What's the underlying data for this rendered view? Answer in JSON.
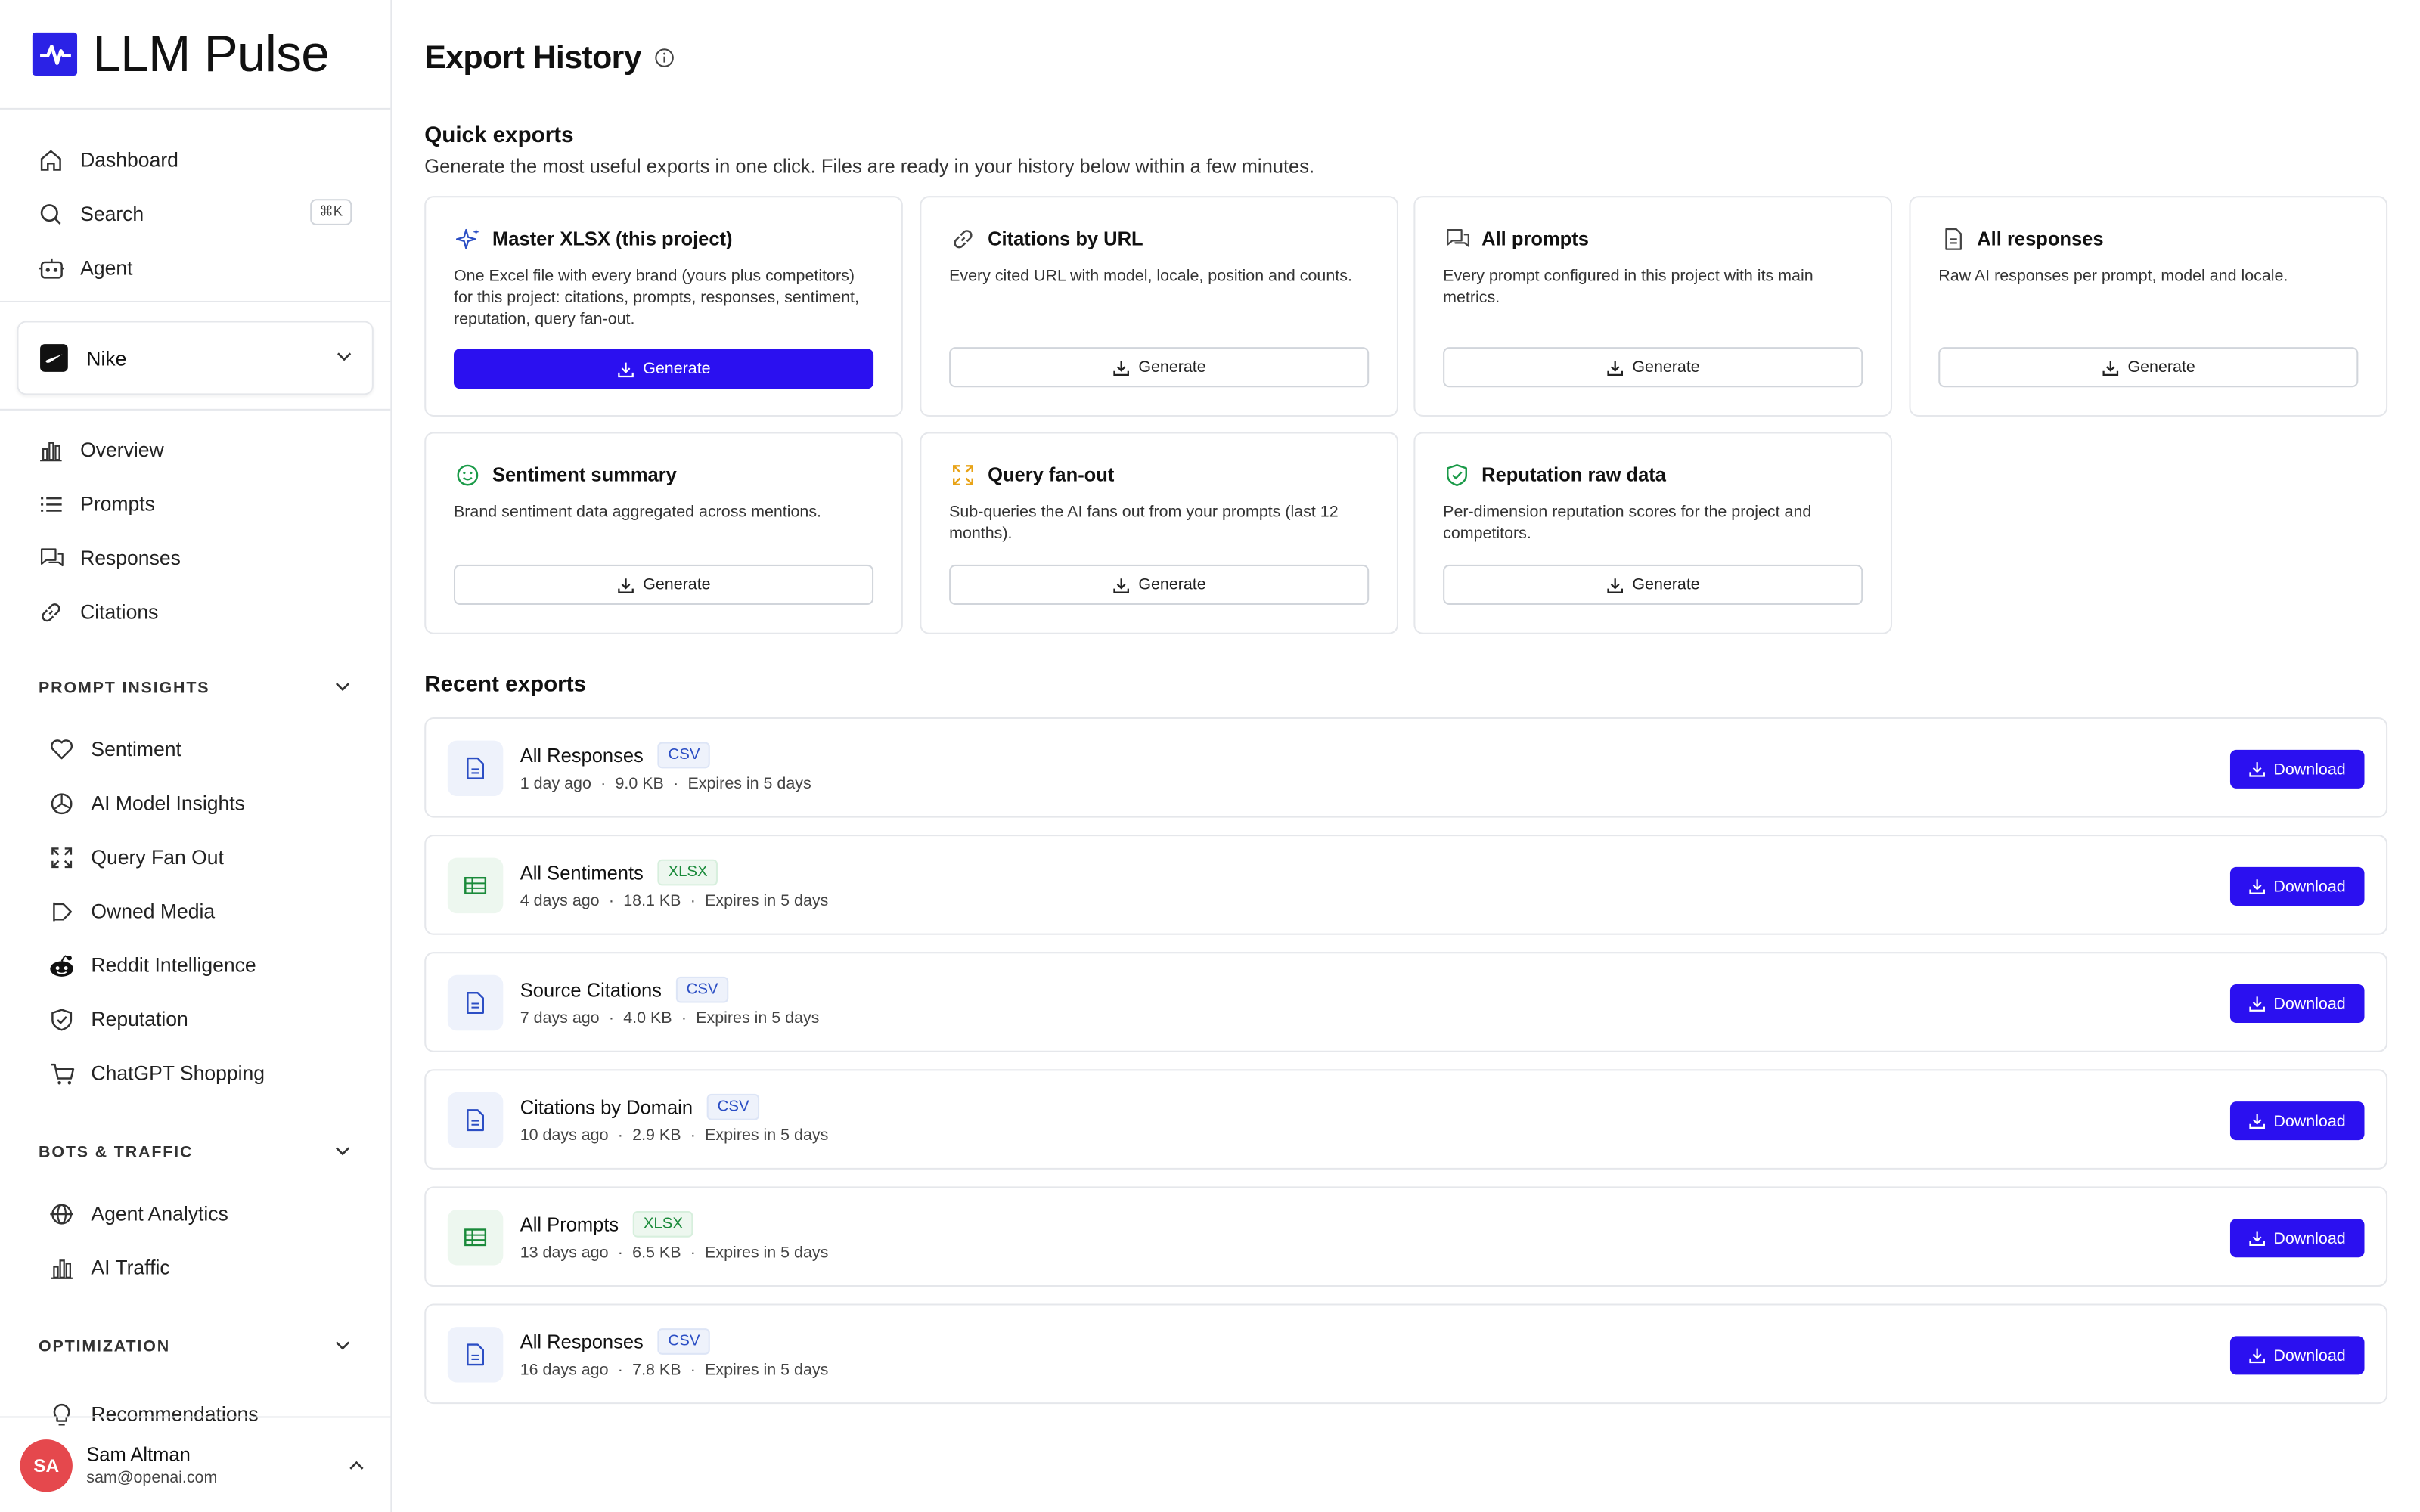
{
  "app": {
    "name": "LLM Pulse"
  },
  "nav_top": [
    {
      "label": "Dashboard",
      "icon": "home-icon"
    },
    {
      "label": "Search",
      "icon": "search-icon",
      "shortcut": "⌘K"
    },
    {
      "label": "Agent",
      "icon": "robot-icon"
    }
  ],
  "brand": {
    "name": "Nike"
  },
  "nav_main": [
    {
      "label": "Overview",
      "icon": "bar-chart-icon"
    },
    {
      "label": "Prompts",
      "icon": "list-icon"
    },
    {
      "label": "Responses",
      "icon": "chat-icon"
    },
    {
      "label": "Citations",
      "icon": "link-icon"
    }
  ],
  "sections": {
    "prompt_insights": {
      "title": "PROMPT INSIGHTS",
      "items": [
        {
          "label": "Sentiment",
          "icon": "heart-icon"
        },
        {
          "label": "AI Model Insights",
          "icon": "pie-chart-icon"
        },
        {
          "label": "Query Fan Out",
          "icon": "expand-icon"
        },
        {
          "label": "Owned Media",
          "icon": "play-flag-icon"
        },
        {
          "label": "Reddit Intelligence",
          "icon": "reddit-icon"
        },
        {
          "label": "Reputation",
          "icon": "shield-icon"
        },
        {
          "label": "ChatGPT Shopping",
          "icon": "cart-icon"
        }
      ]
    },
    "bots_traffic": {
      "title": "BOTS & TRAFFIC",
      "items": [
        {
          "label": "Agent Analytics",
          "icon": "globe-icon"
        },
        {
          "label": "AI Traffic",
          "icon": "bar-chart-icon"
        }
      ]
    },
    "optimization": {
      "title": "OPTIMIZATION",
      "items": [
        {
          "label": "Recommendations",
          "icon": "lightbulb-icon"
        }
      ]
    }
  },
  "user": {
    "initials": "SA",
    "name": "Sam Altman",
    "email": "sam@openai.com"
  },
  "page": {
    "title": "Export History",
    "quick_exports_title": "Quick exports",
    "quick_exports_subtitle": "Generate the most useful exports in one click. Files are ready in your history below within a few minutes.",
    "recent_exports_title": "Recent exports"
  },
  "quick_exports": [
    {
      "title": "Master XLSX (this project)",
      "icon": "sparkle-icon",
      "desc": "One Excel file with every brand (yours plus competitors) for this project: citations, prompts, responses, sentiment, reputation, query fan-out.",
      "button": "Generate",
      "primary": true
    },
    {
      "title": "Citations by URL",
      "icon": "link-icon",
      "desc": "Every cited URL with model, locale, position and counts.",
      "button": "Generate"
    },
    {
      "title": "All prompts",
      "icon": "chat-icon",
      "desc": "Every prompt configured in this project with its main metrics.",
      "button": "Generate"
    },
    {
      "title": "All responses",
      "icon": "document-icon",
      "desc": "Raw AI responses per prompt, model and locale.",
      "button": "Generate"
    },
    {
      "title": "Sentiment summary",
      "icon": "smile-icon",
      "desc": "Brand sentiment data aggregated across mentions.",
      "button": "Generate"
    },
    {
      "title": "Query fan-out",
      "icon": "expand-icon",
      "desc": "Sub-queries the AI fans out from your prompts (last 12 months).",
      "button": "Generate"
    },
    {
      "title": "Reputation raw data",
      "icon": "shield-check-icon",
      "desc": "Per-dimension reputation scores for the project and competitors.",
      "button": "Generate"
    }
  ],
  "recent_exports": [
    {
      "name": "All Responses",
      "format": "CSV",
      "age": "1 day ago",
      "size": "9.0 KB",
      "expires": "Expires in 5 days",
      "button": "Download"
    },
    {
      "name": "All Sentiments",
      "format": "XLSX",
      "age": "4 days ago",
      "size": "18.1 KB",
      "expires": "Expires in 5 days",
      "button": "Download"
    },
    {
      "name": "Source Citations",
      "format": "CSV",
      "age": "7 days ago",
      "size": "4.0 KB",
      "expires": "Expires in 5 days",
      "button": "Download"
    },
    {
      "name": "Citations by Domain",
      "format": "CSV",
      "age": "10 days ago",
      "size": "2.9 KB",
      "expires": "Expires in 5 days",
      "button": "Download"
    },
    {
      "name": "All Prompts",
      "format": "XLSX",
      "age": "13 days ago",
      "size": "6.5 KB",
      "expires": "Expires in 5 days",
      "button": "Download"
    },
    {
      "name": "All Responses",
      "format": "CSV",
      "age": "16 days ago",
      "size": "7.8 KB",
      "expires": "Expires in 5 days",
      "button": "Download"
    }
  ],
  "colors": {
    "accent": "#2b10f0",
    "avatar": "#e5484d"
  }
}
